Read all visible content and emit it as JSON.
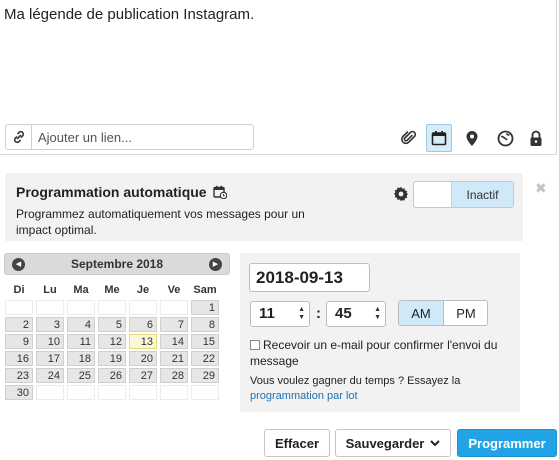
{
  "composer": {
    "caption": "Ma légende de publication Instagram.",
    "link_placeholder": "Ajouter un lien...",
    "tools": [
      "attachment-icon",
      "calendar-icon",
      "location-icon",
      "targeting-icon",
      "privacy-icon"
    ],
    "active_tool": "calendar-icon"
  },
  "schedule": {
    "title": "Programmation automatique",
    "description": "Programmez automatiquement vos messages pour un impact optimal.",
    "toggle_label": "Inactif",
    "close_symbol": "✖"
  },
  "calendar": {
    "month_label": "Septembre 2018",
    "weekdays": [
      "Di",
      "Lu",
      "Ma",
      "Me",
      "Je",
      "Ve",
      "Sam"
    ],
    "weeks": [
      [
        "",
        "",
        "",
        "",
        "",
        "",
        "1"
      ],
      [
        "2",
        "3",
        "4",
        "5",
        "6",
        "7",
        "8"
      ],
      [
        "9",
        "10",
        "11",
        "12",
        "13",
        "14",
        "15"
      ],
      [
        "16",
        "17",
        "18",
        "19",
        "20",
        "21",
        "22"
      ],
      [
        "23",
        "24",
        "25",
        "26",
        "27",
        "28",
        "29"
      ],
      [
        "30",
        "",
        "",
        "",
        "",
        "",
        ""
      ]
    ],
    "today": "13"
  },
  "time": {
    "date_value": "2018-09-13",
    "hour": "11",
    "minute": "45",
    "am_label": "AM",
    "pm_label": "PM",
    "selected_period": "AM",
    "email_checkbox_label": "Recevoir un e-mail pour confirmer l'envoi du message",
    "tip_text": "Vous voulez gagner du temps ? Essayez la",
    "tip_link": "programmation par lot"
  },
  "buttons": {
    "clear": "Effacer",
    "save": "Sauvegarder",
    "schedule": "Programmer"
  },
  "colors": {
    "primary": "#22a3e6",
    "active_tool_bg": "#d7ecf9",
    "toggle_active_bg": "#cfe9f8",
    "today_bg": "#fcf8d4",
    "link": "#1a73b8"
  }
}
